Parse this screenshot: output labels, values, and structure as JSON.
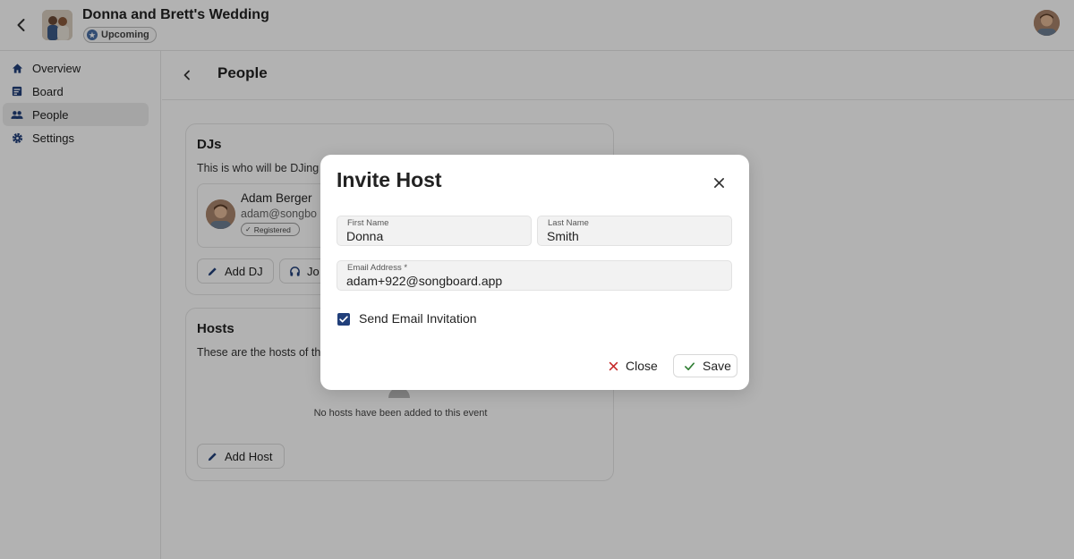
{
  "event": {
    "title": "Donna and Brett's Wedding",
    "status": "Upcoming"
  },
  "sidebar": {
    "items": [
      {
        "label": "Overview",
        "icon": "home-icon",
        "active": false
      },
      {
        "label": "Board",
        "icon": "board-icon",
        "active": false
      },
      {
        "label": "People",
        "icon": "people-icon",
        "active": true
      },
      {
        "label": "Settings",
        "icon": "gear-icon",
        "active": false
      }
    ]
  },
  "page": {
    "title": "People"
  },
  "djs": {
    "title": "DJs",
    "description": "This is who will be DJing",
    "items": [
      {
        "name": "Adam Berger",
        "email": "adam@songbo",
        "badge": "Registered"
      }
    ],
    "add_label": "Add DJ",
    "join_label": "Jo"
  },
  "hosts": {
    "title": "Hosts",
    "description": "These are the hosts of th",
    "empty_text": "No hosts have been added to this event",
    "add_label": "Add Host"
  },
  "modal": {
    "title": "Invite Host",
    "first_name": {
      "label": "First Name",
      "value": "Donna"
    },
    "last_name": {
      "label": "Last Name",
      "value": "Smith"
    },
    "email": {
      "label": "Email Address *",
      "value": "adam+922@songboard.app"
    },
    "send_invite": {
      "label": "Send Email Invitation",
      "checked": true
    },
    "close_label": "Close",
    "save_label": "Save"
  },
  "colors": {
    "accent": "#213f7a",
    "close_red": "#c62828",
    "save_green": "#2e7d32"
  }
}
